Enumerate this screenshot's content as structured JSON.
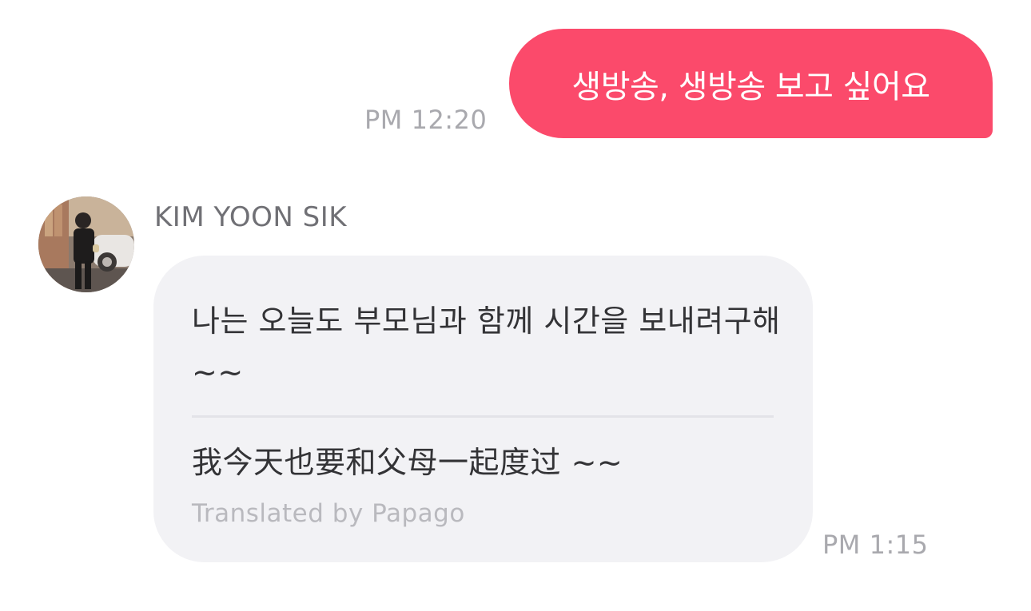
{
  "messages": {
    "outgoing": {
      "text": "생방송, 생방송 보고 싶어요",
      "time": "PM 12:20"
    },
    "incoming": {
      "sender": "KIM YOON SIK",
      "text": "나는 오늘도 부모님과 함께 시간을 보내려구해~~",
      "translation": "我今天也要和父母一起度过 ~~",
      "translated_by": "Translated by Papago",
      "time": "PM 1:15"
    }
  },
  "colors": {
    "outgoing_bubble": "#fb4a6b",
    "incoming_bubble": "#f2f2f5",
    "timestamp": "#a9a9ae"
  },
  "icons": {
    "avatar": "profile-photo"
  }
}
